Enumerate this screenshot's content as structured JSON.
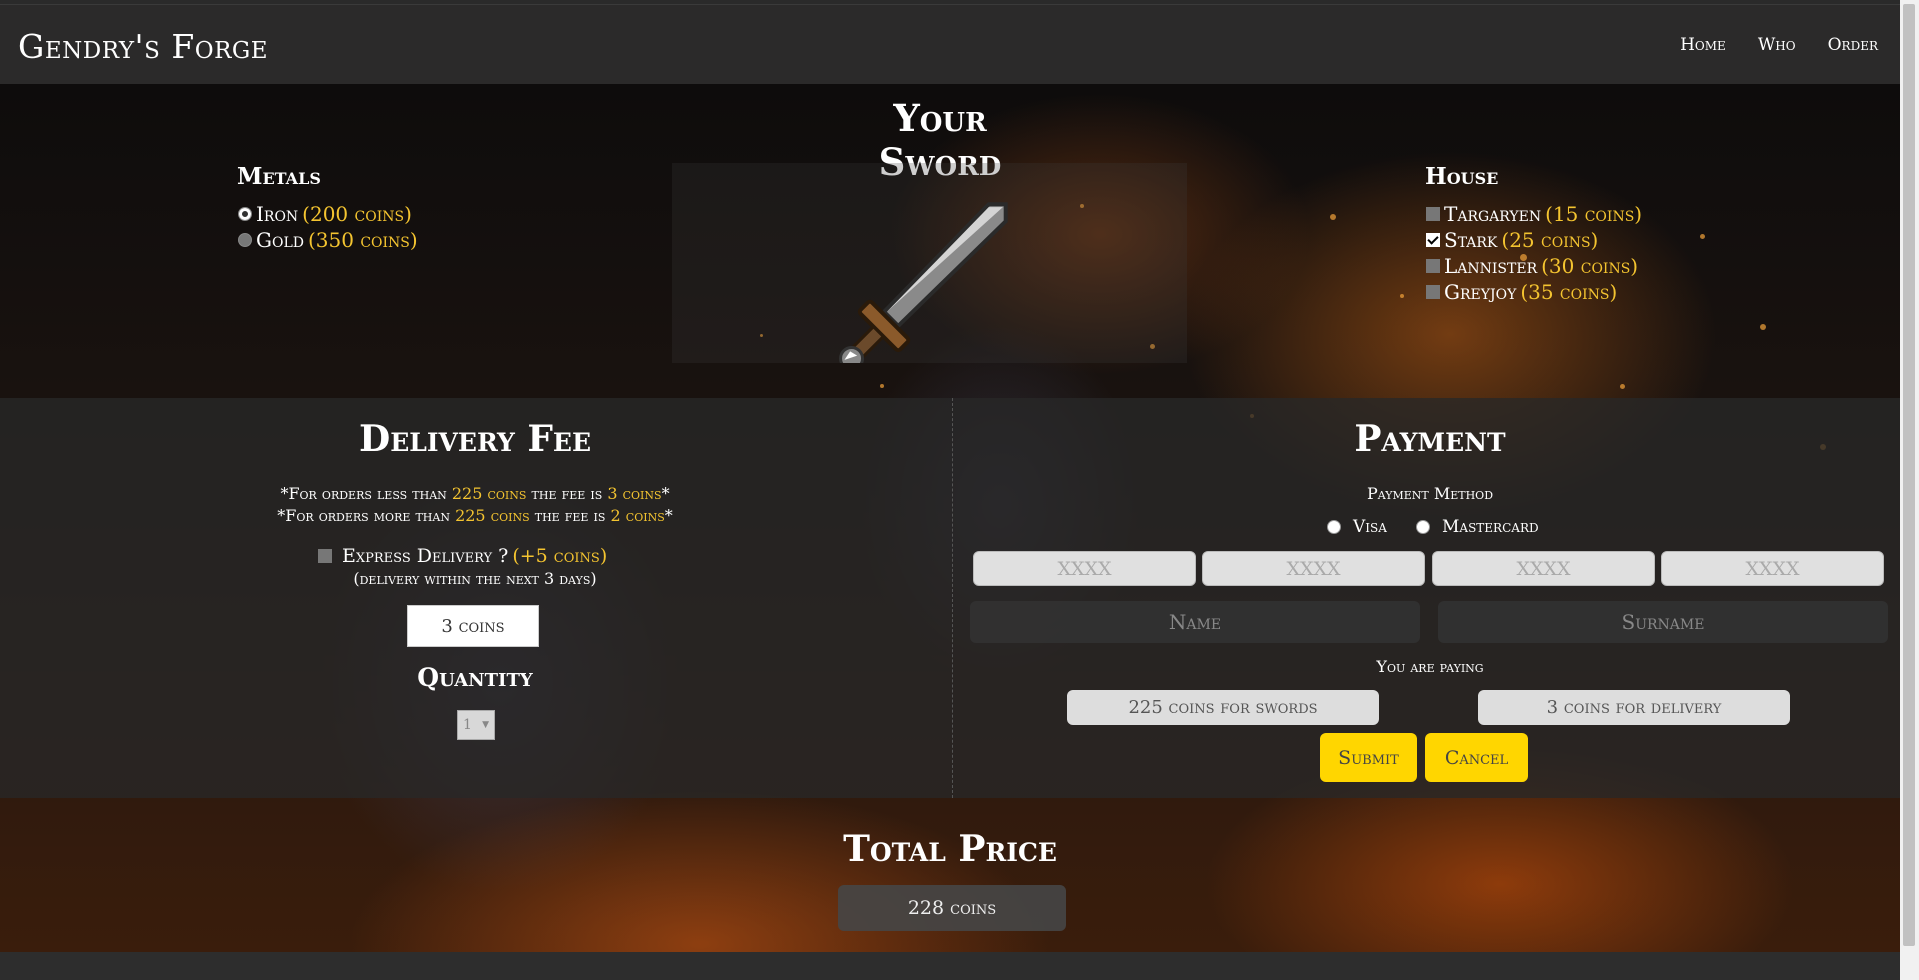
{
  "nav": {
    "brand": "Gendry's Forge",
    "links": [
      "Home",
      "Who",
      "Order"
    ]
  },
  "sword": {
    "title": "Your Sword",
    "metals": {
      "title": "Metals",
      "options": [
        {
          "name": "Iron",
          "price": "(200 coins)",
          "selected": true
        },
        {
          "name": "Gold",
          "price": "(350 coins)",
          "selected": false
        }
      ]
    },
    "house": {
      "title": "House",
      "options": [
        {
          "name": "Targaryen",
          "price": "(15 coins)",
          "checked": false
        },
        {
          "name": "Stark",
          "price": "(25 coins)",
          "checked": true
        },
        {
          "name": "Lannister",
          "price": "(30 coins)",
          "checked": false
        },
        {
          "name": "Greyjoy",
          "price": "(35 coins)",
          "checked": false
        }
      ]
    }
  },
  "delivery": {
    "title": "Delivery Fee",
    "note1_pre": "*For orders less than ",
    "note1_amount": "225 coins",
    "note1_mid": " the fee is ",
    "note1_fee": "3 coins",
    "note1_post": "*",
    "note2_pre": "*For orders more than ",
    "note2_amount": "225 coins",
    "note2_mid": " the fee is ",
    "note2_fee": "2 coins",
    "note2_post": "*",
    "express_label": "Express Delivery ?",
    "express_price": "(+5 coins)",
    "express_note": "(delivery within the next 3 days)",
    "fee_value": "3 coins",
    "quantity_title": "Quantity",
    "quantity_value": "1"
  },
  "payment": {
    "title": "Payment",
    "method_label": "Payment Method",
    "methods": [
      "Visa",
      "Mastercard"
    ],
    "card_placeholder": "XXXX",
    "name_placeholder": "Name",
    "surname_placeholder": "Surname",
    "paying_label": "You are paying",
    "swords_cost": "225 coins for swords",
    "delivery_cost": "3 coins for delivery",
    "submit_label": "Submit",
    "cancel_label": "Cancel"
  },
  "total": {
    "title": "Total Price",
    "value": "228 coins"
  },
  "colors": {
    "accent": "#ffd600",
    "gold_text": "#f4c430"
  }
}
